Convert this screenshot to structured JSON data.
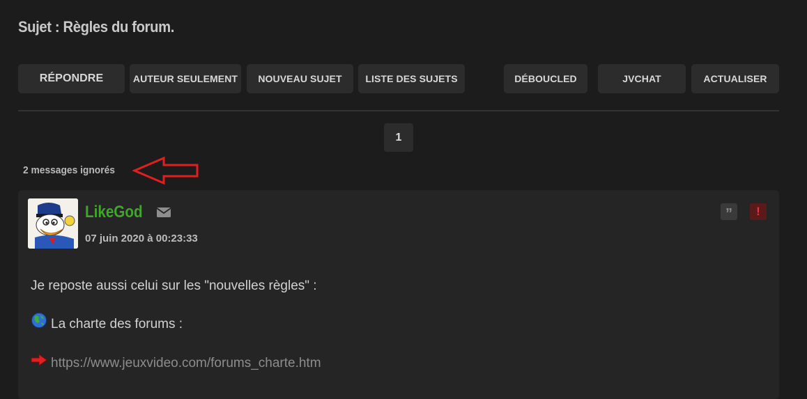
{
  "topic": {
    "title": "Sujet : Règles du forum."
  },
  "toolbar": {
    "reply": "RÉPONDRE",
    "author_only": "AUTEUR SEULEMENT",
    "new_topic": "NOUVEAU SUJET",
    "topic_list": "LISTE DES SUJETS",
    "deboucled": "DÉBOUCLED",
    "jvchat": "JVCHAT",
    "refresh": "ACTUALISER"
  },
  "pagination": {
    "current": "1"
  },
  "ignored": {
    "text": "2 messages ignorés"
  },
  "post": {
    "author": "LikeGod",
    "date": "07 juin 2020 à 00:23:33",
    "line1": "Je reposte aussi celui sur les \"nouvelles règles\" :",
    "line2": "La charte des forums :",
    "link": "https://www.jeuxvideo.com/forums_charte.htm",
    "quote_icon": "”",
    "alert_icon": "!"
  },
  "colors": {
    "background": "#1c1c1c",
    "button": "#2c2c2c",
    "author": "#3fa62b",
    "annotation_arrow": "#e0201e"
  },
  "icons": [
    "mail-icon",
    "quote-icon",
    "alert-icon",
    "globe-icon",
    "red-arrow-icon"
  ]
}
